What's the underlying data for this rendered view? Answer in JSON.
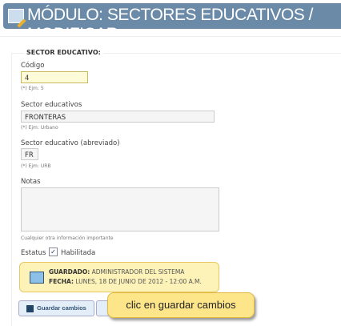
{
  "header": {
    "title": "MÓDULO: SECTORES EDUCATIVOS / MODIFICAR"
  },
  "form": {
    "legend": "SECTOR EDUCATIVO:",
    "codigo": {
      "label": "Código",
      "value": "4",
      "hint": "(*) Ejm: 5"
    },
    "sector": {
      "label": "Sector educativos",
      "value": "FRONTERAS",
      "hint": "(*) Ejm: Urbano"
    },
    "abrev": {
      "label": "Sector educativo (abreviado)",
      "value": "FR",
      "hint": "(*) Ejm: URB"
    },
    "notas": {
      "label": "Notas",
      "value": "",
      "hint": "Cualquier otra información importante"
    },
    "estatus": {
      "label": "Estatus",
      "checkbox_label": "Habilitada",
      "checked": true
    }
  },
  "info": {
    "saved_label": "GUARDADO:",
    "saved_value": "ADMINISTRADOR DEL SISTEMA",
    "date_label": "FECHA:",
    "date_value": "LUNES, 18 DE JUNIO DE 2012 - 12:00 A.M."
  },
  "buttons": {
    "save": "Guardar cambios"
  },
  "callout": "clic en guardar cambios"
}
